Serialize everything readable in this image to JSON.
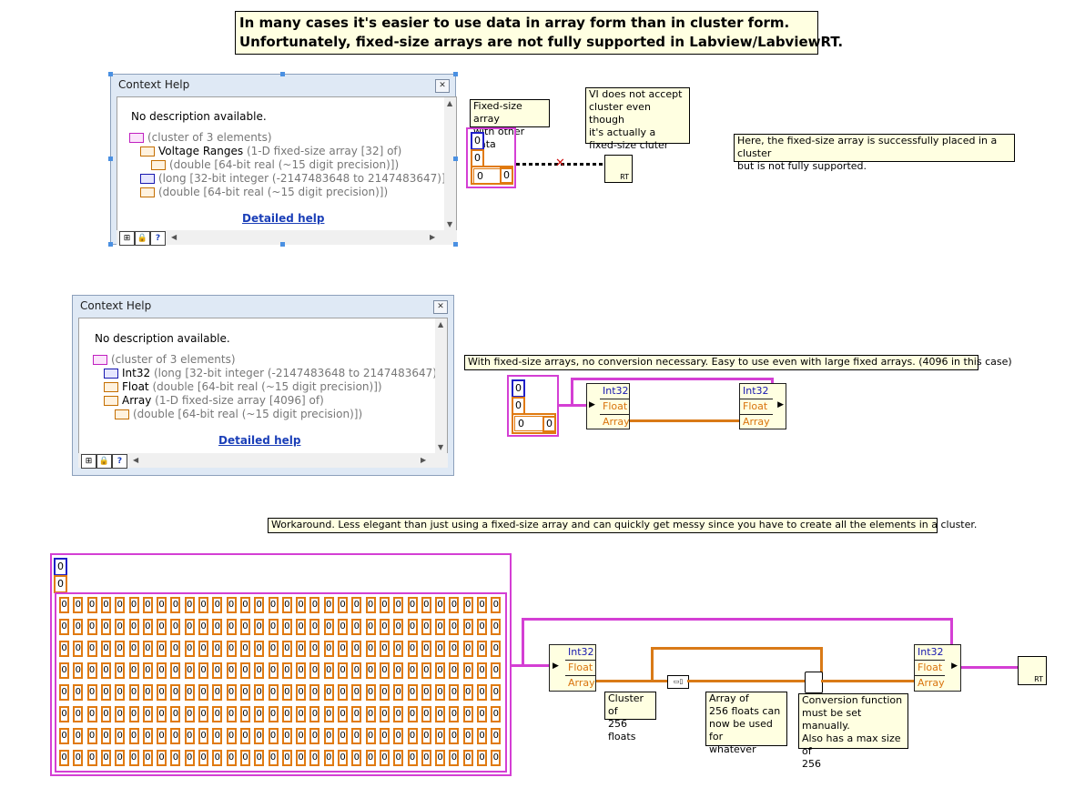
{
  "banner": {
    "line1": "In many cases it's easier to use data in array form than in cluster form.",
    "line2": "Unfortunately, fixed-size arrays are not fully supported in Labview/LabviewRT."
  },
  "help1": {
    "title": "Context Help",
    "description": "No description available.",
    "lines": [
      {
        "icon": "cluster",
        "name": "",
        "detail": "(cluster of 3 elements)"
      },
      {
        "icon": "array",
        "name": "Voltage Ranges",
        "detail": " (1-D fixed-size array [32] of)"
      },
      {
        "icon": "dbl",
        "name": "",
        "detail": "(double [64-bit real (~15 digit precision)])"
      },
      {
        "icon": "i32",
        "name": "",
        "detail": "(long [32-bit integer (-2147483648 to 2147483647)])"
      },
      {
        "icon": "dbl",
        "name": "",
        "detail": "(double [64-bit real (~15 digit precision)])"
      }
    ],
    "link": "Detailed help"
  },
  "help2": {
    "title": "Context Help",
    "description": "No description available.",
    "lines": [
      {
        "icon": "cluster",
        "name": "",
        "detail": "(cluster of 3 elements)"
      },
      {
        "icon": "i32",
        "name": "Int32",
        "detail": " (long [32-bit integer (-2147483648 to 2147483647)])"
      },
      {
        "icon": "dbl",
        "name": "Float",
        "detail": " (double [64-bit real (~15 digit precision)])"
      },
      {
        "icon": "array",
        "name": "Array",
        "detail": " (1-D fixed-size array [4096] of)"
      },
      {
        "icon": "dbl",
        "name": "",
        "detail": "(double [64-bit real (~15 digit precision)])"
      }
    ],
    "link": "Detailed help"
  },
  "notes": {
    "fixed_array": "Fixed-size array\nwith other data",
    "vi_not_accept": "VI does not accept\ncluster even though\nit's actually a\nfixed-size cluter",
    "here": "Here, the fixed-size array is successfully placed in a cluster\nbut is not fully supported.",
    "with_fixed": "With fixed-size arrays, no conversion necessary.  Easy to use even with large fixed arrays.  (4096 in this case)",
    "workaround": "Workaround.  Less elegant than just using a fixed-size array and can quickly get messy since you have to create all the elements in a cluster.",
    "cluster256": "Cluster of\n256 floats",
    "array256": "Array of\n256 floats can\nnow be used for\nwhatever",
    "conversion": "Conversion function\nmust be set manually.\nAlso has a max size of\n256"
  },
  "bundle_labels": {
    "int32": "Int32",
    "float": "Float",
    "array": "Array"
  },
  "values": {
    "zero": "0"
  },
  "icons": {
    "rt": "RT",
    "dbl": "DBL",
    "i32": "I32",
    "array": "[ ]",
    "cluster": "▣"
  },
  "colors": {
    "cluster_wire": "#d43fd4",
    "double_wire": "#d97a17",
    "int_wire": "#2020c8",
    "note_bg": "#ffffe1"
  }
}
